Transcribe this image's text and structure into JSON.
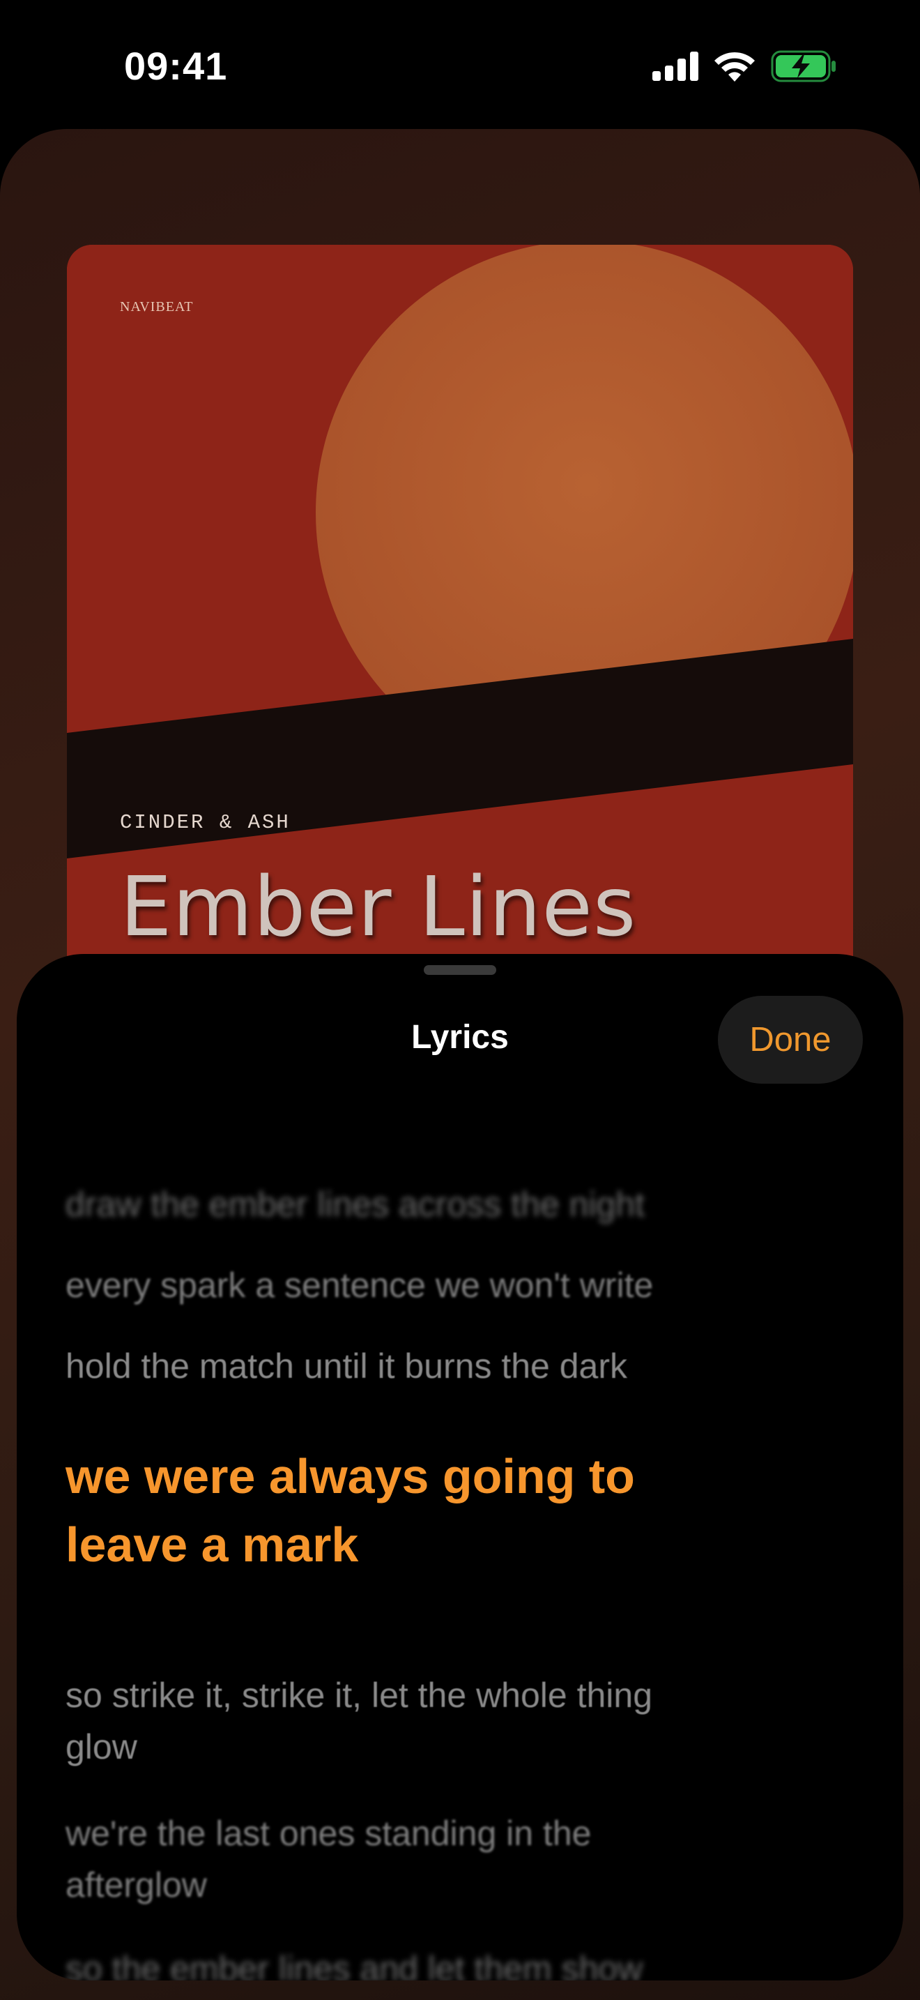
{
  "status_bar": {
    "time": "09:41",
    "icons": [
      "cellular-signal-icon",
      "wifi-icon",
      "battery-charging-icon"
    ],
    "battery_color": "#34c759"
  },
  "album": {
    "label": "NAVIBEAT",
    "artist": "CINDER & ASH",
    "title": "Ember Lines",
    "colors": {
      "background": "#8e2418",
      "sun": "#b25a2a",
      "band": "#150c0a"
    }
  },
  "lyrics_sheet": {
    "title": "Lyrics",
    "done_label": "Done",
    "accent_color": "#f7962d",
    "lines": [
      "draw the ember lines across the night",
      "every spark a sentence we won't write",
      "hold the match until it burns the dark",
      "we were always going to leave a mark",
      "so strike it, strike it, let the whole thing glow",
      "we're the last ones standing in the afterglow",
      "so the ember lines and let them show"
    ],
    "current_line_index": 3
  }
}
